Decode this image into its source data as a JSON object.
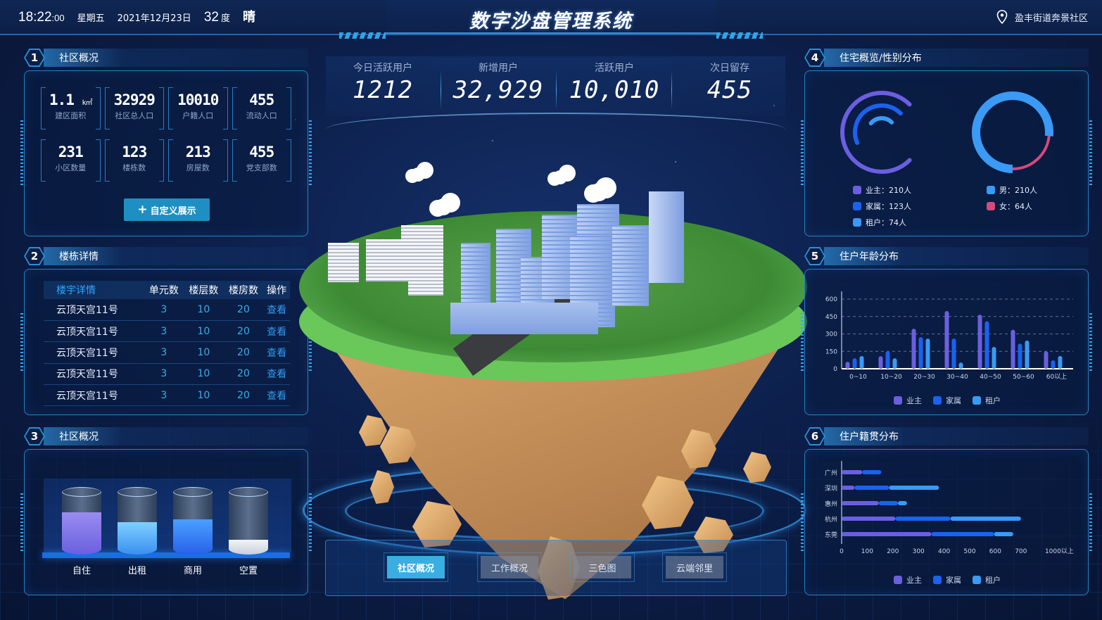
{
  "header": {
    "time_hm": "18:22",
    "time_s": ":00",
    "weekday": "星期五",
    "date": "2021年12月23日",
    "temperature": "32",
    "temperature_unit": "度",
    "weather": "晴",
    "title": "数字沙盘管理系统",
    "location": "盈丰街道奔景社区",
    "location_icon": "map-pin-icon"
  },
  "panel1": {
    "index": "1",
    "title": "社区概况",
    "stats": [
      {
        "value": "1.1",
        "unit": "k㎡",
        "label": "建区面积"
      },
      {
        "value": "32929",
        "unit": "",
        "label": "社区总人口"
      },
      {
        "value": "10010",
        "unit": "",
        "label": "户籍人口"
      },
      {
        "value": "455",
        "unit": "",
        "label": "流动人口"
      },
      {
        "value": "231",
        "unit": "",
        "label": "小区数量"
      },
      {
        "value": "123",
        "unit": "",
        "label": "楼栋数"
      },
      {
        "value": "213",
        "unit": "",
        "label": "房屋数"
      },
      {
        "value": "455",
        "unit": "",
        "label": "党支部数"
      }
    ],
    "button_icon": "+",
    "button_label": "自定义展示"
  },
  "panel2": {
    "index": "2",
    "title": "楼栋详情",
    "columns": [
      "楼宇详情",
      "单元数",
      "楼层数",
      "楼房数",
      "操作"
    ],
    "rows": [
      {
        "name": "云顶天宫11号",
        "units": "3",
        "floors": "10",
        "rooms": "20",
        "action": "查看"
      },
      {
        "name": "云顶天宫11号",
        "units": "3",
        "floors": "10",
        "rooms": "20",
        "action": "查看"
      },
      {
        "name": "云顶天宫11号",
        "units": "3",
        "floors": "10",
        "rooms": "20",
        "action": "查看"
      },
      {
        "name": "云顶天宫11号",
        "units": "3",
        "floors": "10",
        "rooms": "20",
        "action": "查看"
      },
      {
        "name": "云顶天宫11号",
        "units": "3",
        "floors": "10",
        "rooms": "20",
        "action": "查看"
      }
    ]
  },
  "panel3": {
    "index": "3",
    "title": "社区概况",
    "cylinders": [
      {
        "label": "自住",
        "level": 0.62,
        "color_top": "#9a8cf0",
        "color_bottom": "#6a5fe0"
      },
      {
        "label": "出租",
        "level": 0.48,
        "color_top": "#7fd0ff",
        "color_bottom": "#3a8ff0"
      },
      {
        "label": "商用",
        "level": 0.52,
        "color_top": "#4aa0ff",
        "color_bottom": "#2860e8"
      },
      {
        "label": "空置",
        "level": 0.22,
        "color_top": "#f2f4f8",
        "color_bottom": "#c9ced8"
      }
    ]
  },
  "kpis": [
    {
      "label": "今日活跃用户",
      "value": "1212"
    },
    {
      "label": "新增用户",
      "value": "32,929"
    },
    {
      "label": "活跃用户",
      "value": "10,010"
    },
    {
      "label": "次日留存",
      "value": "455"
    }
  ],
  "tabs": [
    {
      "label": "社区概况",
      "active": true
    },
    {
      "label": "工作概况",
      "active": false
    },
    {
      "label": "三色图",
      "active": false
    },
    {
      "label": "云端邻里",
      "active": false
    }
  ],
  "panel4": {
    "index": "4",
    "title": "住宅概览/性别分布"
  },
  "panel5": {
    "index": "5",
    "title": "住户年龄分布"
  },
  "panel6": {
    "index": "6",
    "title": "住户籍贯分布"
  },
  "colors": {
    "owner": "#6b5fe0",
    "family": "#1a62f0",
    "tenant": "#3a9af5",
    "male": "#3a9af5",
    "female": "#d54a7a",
    "accent": "#2ea6ff"
  },
  "chart_data": [
    {
      "type": "pie",
      "title": "住宅概览",
      "style": "radial-arcs",
      "series": [
        {
          "name": "业主",
          "value": 210,
          "unit": "人",
          "legend": "业主：210人"
        },
        {
          "name": "家属",
          "value": 123,
          "unit": "人",
          "legend": "家属：123人"
        },
        {
          "name": "租户",
          "value": 74,
          "unit": "人",
          "legend": "租户：74人"
        }
      ]
    },
    {
      "type": "pie",
      "title": "性别分布",
      "style": "donut",
      "series": [
        {
          "name": "男",
          "value": 210,
          "unit": "人",
          "legend": "男：210人"
        },
        {
          "name": "女",
          "value": 64,
          "unit": "人",
          "legend": "女：64人"
        }
      ]
    },
    {
      "type": "bar",
      "title": "住户年龄分布",
      "categories": [
        "0~10",
        "10~20",
        "20~30",
        "30~40",
        "40~50",
        "50~60",
        "60以上"
      ],
      "series": [
        {
          "name": "业主",
          "values": [
            60,
            108,
            345,
            497,
            466,
            336,
            150
          ]
        },
        {
          "name": "家属",
          "values": [
            90,
            150,
            272,
            260,
            409,
            217,
            73
          ]
        },
        {
          "name": "租户",
          "values": [
            110,
            90,
            260,
            53,
            188,
            243,
            110
          ]
        }
      ],
      "yticks": [
        0,
        150,
        300,
        450,
        600
      ],
      "ylim": [
        0,
        650
      ],
      "grid": true,
      "legend": "bottom"
    },
    {
      "type": "bar",
      "orientation": "horizontal",
      "stacked": true,
      "title": "住户籍贯分布",
      "categories": [
        "广州",
        "深圳",
        "惠州",
        "杭州",
        "东莞"
      ],
      "series": [
        {
          "name": "业主",
          "values": [
            80,
            50,
            145,
            210,
            350
          ]
        },
        {
          "name": "家属",
          "values": [
            75,
            135,
            75,
            215,
            245
          ]
        },
        {
          "name": "租户",
          "values": [
            0,
            195,
            35,
            275,
            75
          ]
        }
      ],
      "xticks": [
        "0",
        "100",
        "200",
        "300",
        "400",
        "500",
        "600",
        "700",
        "1000以上"
      ],
      "xlim": [
        0,
        800
      ],
      "legend": "bottom"
    }
  ]
}
